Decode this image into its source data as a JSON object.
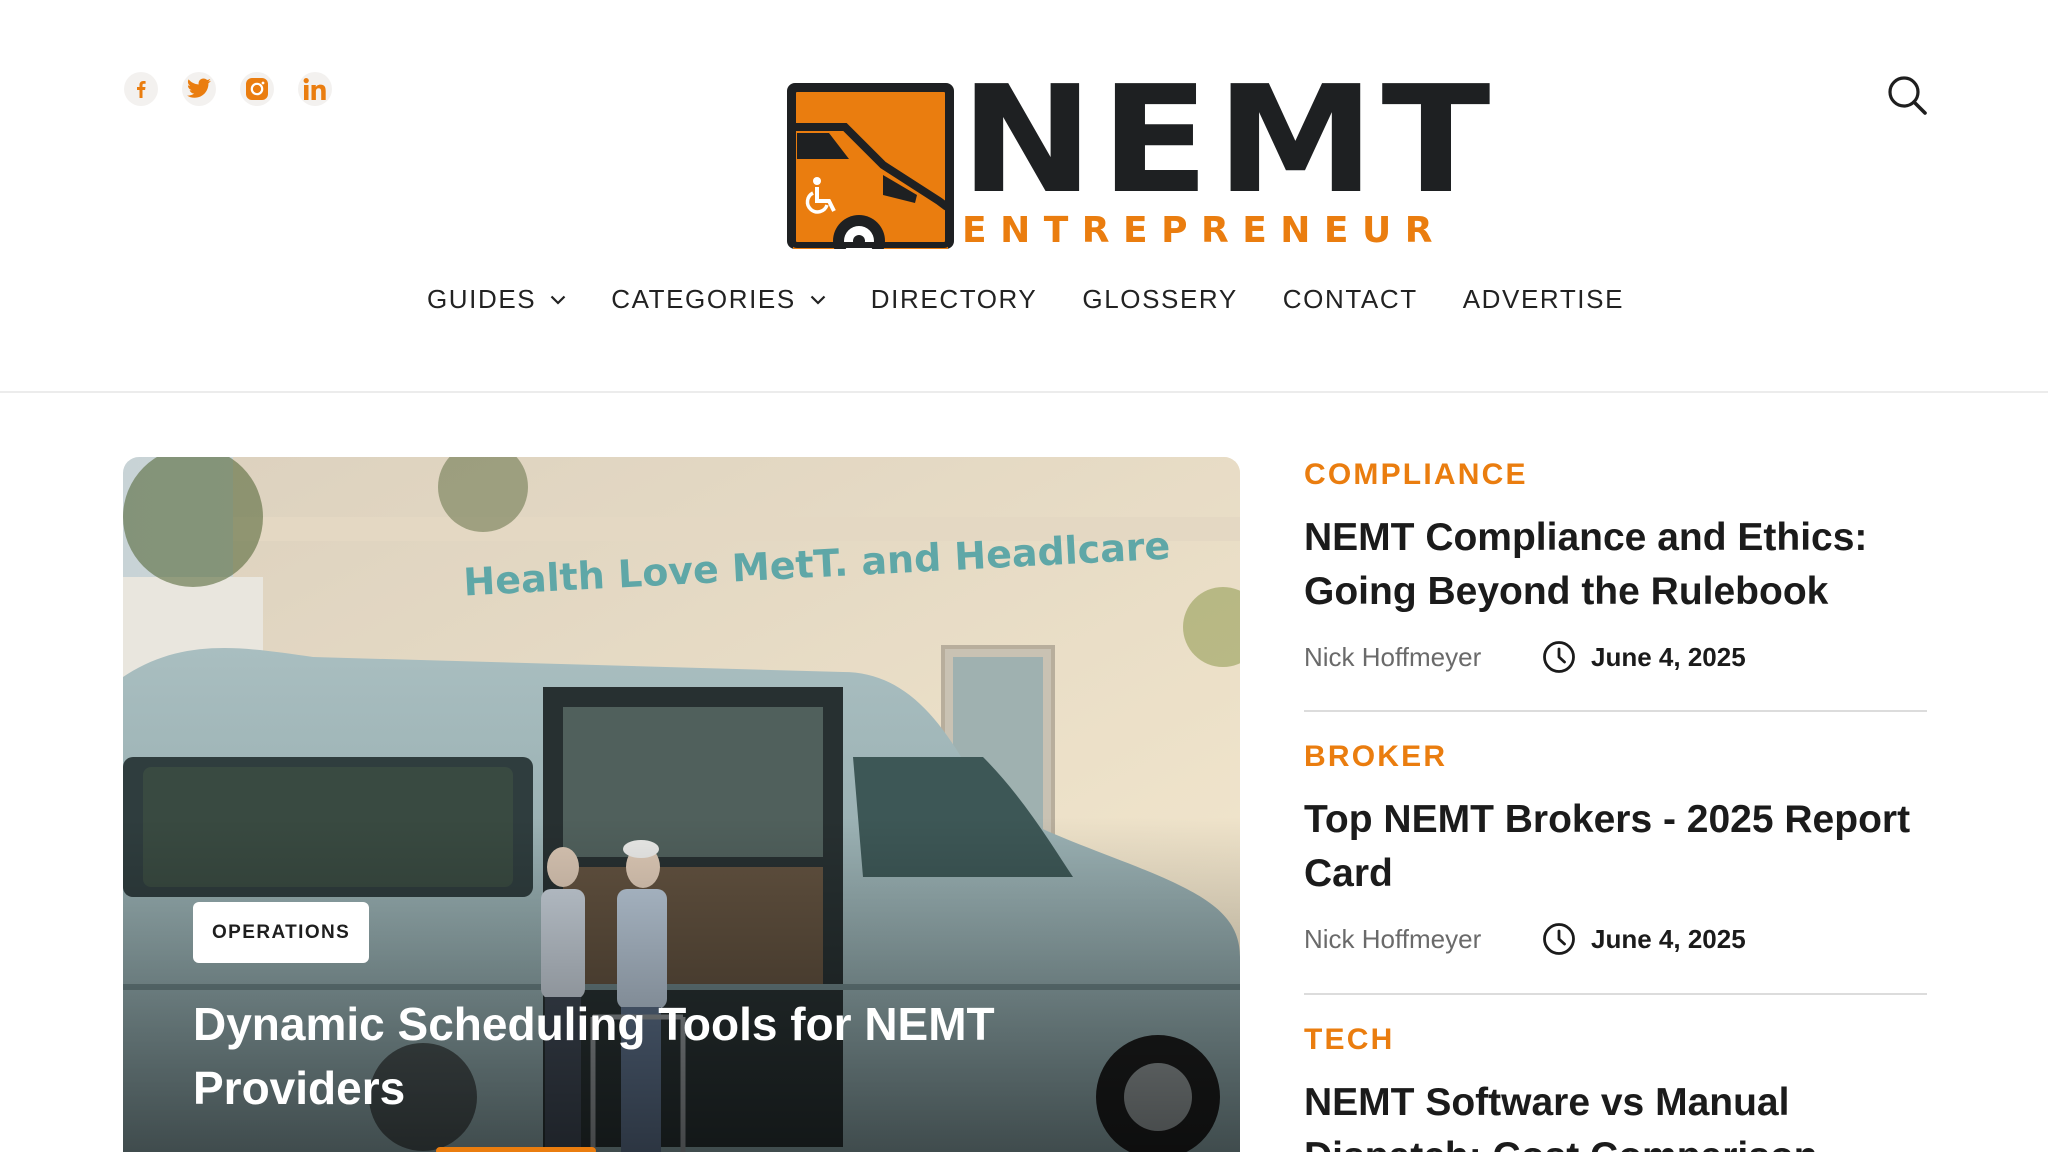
{
  "header": {
    "socials": [
      {
        "name": "facebook-icon"
      },
      {
        "name": "twitter-icon"
      },
      {
        "name": "instagram-icon"
      },
      {
        "name": "linkedin-icon"
      }
    ],
    "logo": {
      "word": "NEMT",
      "sub": "ENTREPRENEUR"
    },
    "search_icon": "search-icon"
  },
  "nav": {
    "items": [
      {
        "label": "GUIDES",
        "has_dropdown": true
      },
      {
        "label": "CATEGORIES",
        "has_dropdown": true
      },
      {
        "label": "DIRECTORY",
        "has_dropdown": false
      },
      {
        "label": "GLOSSERY",
        "has_dropdown": false
      },
      {
        "label": "CONTACT",
        "has_dropdown": false
      },
      {
        "label": "ADVERTISE",
        "has_dropdown": false
      }
    ]
  },
  "hero": {
    "tag": "OPERATIONS",
    "title": "Dynamic Scheduling Tools for NEMT Providers",
    "building_sign": "Health Love MetT. and Headlcare"
  },
  "posts": [
    {
      "category": "COMPLIANCE",
      "title": "NEMT Compliance and Ethics: Going Beyond the Rulebook",
      "author": "Nick Hoffmeyer",
      "date": "June 4, 2025"
    },
    {
      "category": "BROKER",
      "title": "Top NEMT Brokers - 2025 Report Card",
      "author": "Nick Hoffmeyer",
      "date": "June 4, 2025"
    },
    {
      "category": "TECH",
      "title": "NEMT Software vs Manual Dispatch: Cost Comparison",
      "author": "",
      "date": ""
    }
  ],
  "colors": {
    "accent": "#ea7d0f",
    "dark": "#1e2022",
    "divider": "#dcdcdc"
  }
}
